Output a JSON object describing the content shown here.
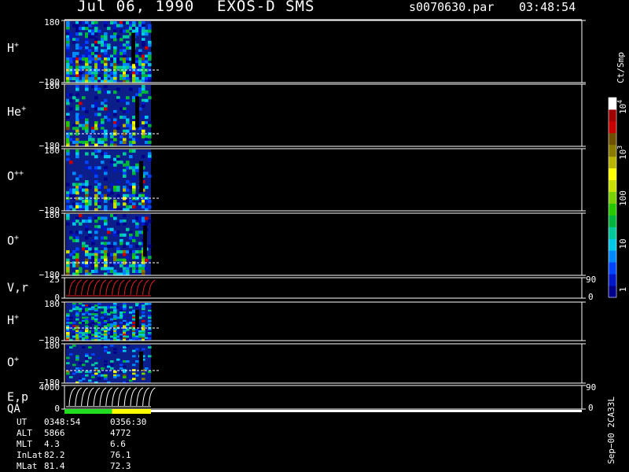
{
  "header": {
    "date": "Jul 06, 1990",
    "instrument": "EXOS-D SMS",
    "file": "s0070630.par",
    "time": "03:48:54"
  },
  "chart_data": {
    "type": "heatmap",
    "panels": [
      {
        "label": "H",
        "sup": "+",
        "ytop": "180",
        "ybot": "−180",
        "ylim": [
          -180,
          180
        ],
        "kind": "spectro",
        "density": 0.9
      },
      {
        "label": "He",
        "sup": "+",
        "ytop": "180",
        "ybot": "−180",
        "ylim": [
          -180,
          180
        ],
        "kind": "spectro",
        "density": 0.45
      },
      {
        "label": "O",
        "sup": "++",
        "ytop": "180",
        "ybot": "−180",
        "ylim": [
          -180,
          180
        ],
        "kind": "spectro",
        "density": 0.5
      },
      {
        "label": "O",
        "sup": "+",
        "ytop": "180",
        "ybot": "−180",
        "ylim": [
          -180,
          180
        ],
        "kind": "spectro",
        "density": 0.55
      },
      {
        "label": "V,r",
        "sup": "",
        "ytop": "25",
        "ybot": "0",
        "ylim": [
          0,
          25
        ],
        "kind": "lines",
        "color": "#e02020",
        "right_top": "90",
        "right_bot": "0"
      },
      {
        "label": "H",
        "sup": "+",
        "ytop": "180",
        "ybot": "−180",
        "ylim": [
          -180,
          180
        ],
        "kind": "spectro",
        "density": 0.8
      },
      {
        "label": "O",
        "sup": "+",
        "ytop": "180",
        "ybot": "−180",
        "ylim": [
          -180,
          180
        ],
        "kind": "spectro",
        "density": 0.3
      },
      {
        "label": "E,p",
        "sup": "",
        "ytop": "4000",
        "ybot": "0",
        "ylim": [
          0,
          4000
        ],
        "kind": "lines",
        "color": "#ffffff",
        "right_top": "90",
        "right_bot": "0"
      }
    ],
    "qa_label": "QA",
    "qa_segments": [
      {
        "color": "#22dd22",
        "span": [
          0,
          0.55
        ]
      },
      {
        "color": "#ffff00",
        "span": [
          0.55,
          1.0
        ]
      }
    ],
    "colorbar": {
      "label": "Ct/Smp",
      "ticks": [
        {
          "label": "1",
          "value": 1
        },
        {
          "label": "10",
          "value": 10
        },
        {
          "label": "100",
          "value": 100
        },
        {
          "label": "10",
          "sup": "3",
          "value": 1000
        },
        {
          "label": "10",
          "sup": "4",
          "value": 10000
        }
      ],
      "colors": [
        "#00008b",
        "#0018c8",
        "#0044ff",
        "#0088ff",
        "#00c8e8",
        "#00c89a",
        "#00b43c",
        "#28c800",
        "#7ad000",
        "#c8e000",
        "#ffff00",
        "#b8b400",
        "#8a7a00",
        "#6e5000",
        "#c80000",
        "#a00000",
        "#ffffff"
      ]
    },
    "orbit_table": {
      "rows": [
        {
          "name": "UT",
          "v1": "0348:54",
          "v2": "0356:30"
        },
        {
          "name": "ALT",
          "v1": "5866",
          "v2": "4772"
        },
        {
          "name": "MLT",
          "v1": "4.3",
          "v2": "6.6"
        },
        {
          "name": "InLat",
          "v1": "82.2",
          "v2": "76.1"
        },
        {
          "name": "MLat",
          "v1": "81.4",
          "v2": "72.3"
        }
      ]
    },
    "side_note": "Sep−00 2CA33L"
  }
}
